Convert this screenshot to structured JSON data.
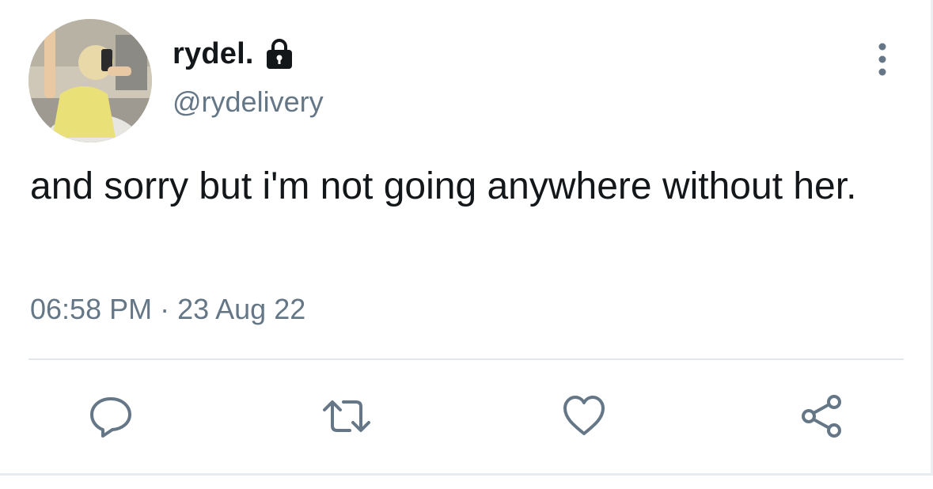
{
  "user": {
    "display_name": "rydel.",
    "handle": "@rydelivery",
    "protected_icon": "lock-icon",
    "avatar": "profile-photo"
  },
  "tweet": {
    "text": "and sorry but i'm not going anywhere without her.",
    "timestamp": "06:58 PM · 23 Aug 22"
  },
  "menu": {
    "icon": "more-vertical-icon"
  },
  "actions": [
    {
      "name": "reply",
      "icon": "reply-icon"
    },
    {
      "name": "retweet",
      "icon": "retweet-icon"
    },
    {
      "name": "like",
      "icon": "heart-icon"
    },
    {
      "name": "share",
      "icon": "share-icon"
    }
  ],
  "colors": {
    "text_primary": "#14171a",
    "text_secondary": "#657786",
    "divider": "#e1e8ed",
    "background": "#ffffff"
  }
}
